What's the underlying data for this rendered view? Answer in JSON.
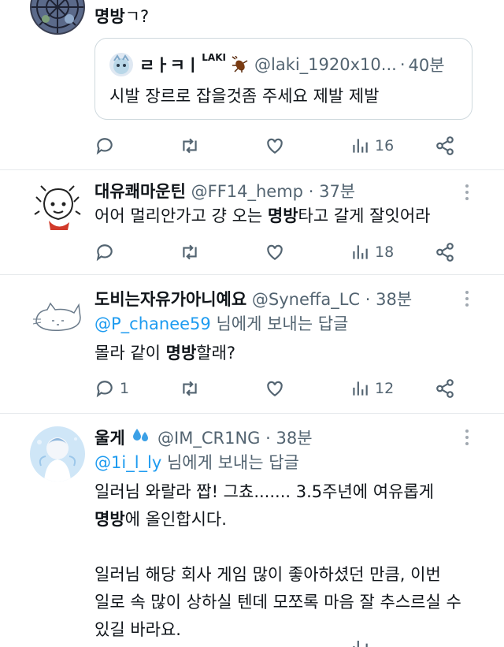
{
  "tweets": [
    {
      "text_html_parts": [
        "명방",
        "ㄱ?"
      ],
      "quote": {
        "name": "ㄹㅏㅋㅣ",
        "sup": "LAKI",
        "handle": "@laki_1920x10...",
        "dot": "·",
        "time": "40분",
        "text": "시발 장르로 잡을것좀 주세요 제발 제발"
      },
      "actions": {
        "reply": "",
        "retweet": "",
        "like": "",
        "views": "16"
      }
    },
    {
      "name": "대유쾌마운틴",
      "handle": "@FF14_hemp",
      "dot": "·",
      "time": "37분",
      "text_before": "어어 멀리안가고 걍 오는 ",
      "text_bold": "명방",
      "text_after": "타고 갈게 잘잇어라",
      "actions": {
        "reply": "",
        "retweet": "",
        "like": "",
        "views": "18"
      }
    },
    {
      "name": "도비는자유가아니예요",
      "handle": "@Syneffa_LC",
      "dot": "·",
      "time": "38분",
      "reply_to": "@P_chanee59",
      "reply_suffix": " 님에게 보내는 답글",
      "text_before": "몰라 같이 ",
      "text_bold": "명방",
      "text_after": "할래?",
      "actions": {
        "reply": "1",
        "retweet": "",
        "like": "",
        "views": "12"
      }
    },
    {
      "name": "울게",
      "handle": "@IM_CR1NG",
      "dot": "·",
      "time": "38분",
      "reply_to": "@1i_l_ly",
      "reply_suffix": " 님에게 보내는 답글",
      "line1": "일러님 와랄라 짭! 그쵸....... 3.5주년에 여유롭게",
      "line2_bold": "명방",
      "line2_after": "에 올인합시다.",
      "line3": "일러님 해당 회사 게임 많이 좋아하셨던 만큼, 이번",
      "line4": "일로 속 많이 상하실 텐데 모쪼록 마음 잘 추스르실 수",
      "line5": "있길 바라요."
    }
  ]
}
